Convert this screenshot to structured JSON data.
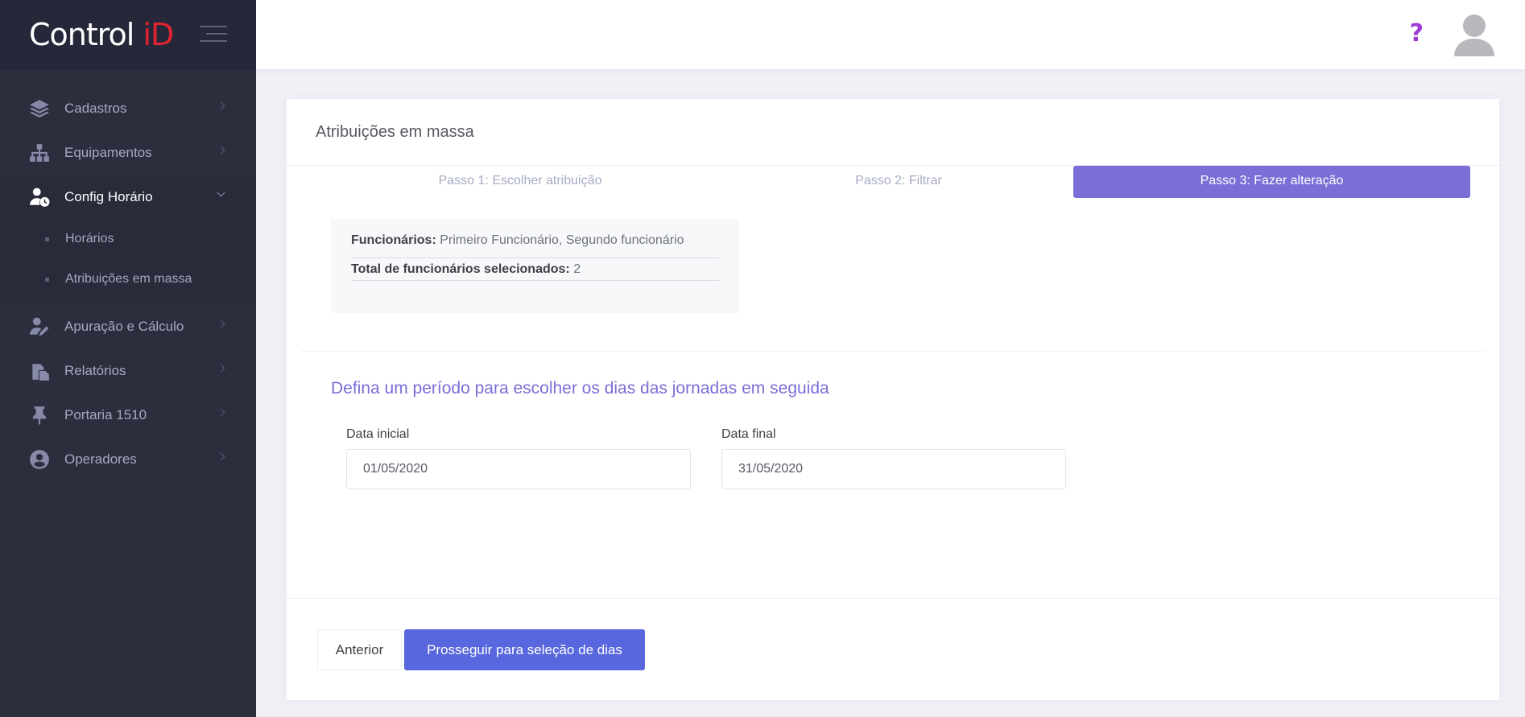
{
  "brand": {
    "logo_main": "Control ",
    "logo_accent": "iD"
  },
  "sidebar": {
    "items": [
      {
        "label": "Cadastros",
        "icon": "layers-icon"
      },
      {
        "label": "Equipamentos",
        "icon": "sitemap-icon"
      },
      {
        "label": "Config Horário",
        "icon": "user-clock-icon",
        "open": true,
        "subitems": [
          {
            "label": "Horários"
          },
          {
            "label": "Atribuições em massa"
          }
        ]
      },
      {
        "label": "Apuração e Cálculo",
        "icon": "user-edit-icon"
      },
      {
        "label": "Relatórios",
        "icon": "copy-files-icon"
      },
      {
        "label": "Portaria 1510",
        "icon": "thumbtack-icon"
      },
      {
        "label": "Operadores",
        "icon": "user-circle-icon"
      }
    ]
  },
  "header": {
    "help_label": "?"
  },
  "card": {
    "title": "Atribuições em massa",
    "steps": [
      {
        "label": "Passo 1: Escolher atribuição"
      },
      {
        "label": "Passo 2: Filtrar"
      },
      {
        "label": "Passo 3: Fazer alteração",
        "active": true
      }
    ],
    "summary": {
      "employees_label": "Funcionários:",
      "employees_value": " Primeiro Funcionário, Segundo funcionário",
      "total_label": "Total de funcionários selecionados:",
      "total_value": " 2"
    },
    "section_title": "Defina um período para escolher os dias das jornadas em seguida",
    "start_date": {
      "label": "Data inicial",
      "value": "01/05/2020"
    },
    "end_date": {
      "label": "Data final",
      "value": "31/05/2020"
    },
    "buttons": {
      "prev": "Anterior",
      "next": "Prosseguir para seleção de dias"
    }
  },
  "colors": {
    "sidebar_bg": "#2c2e3e",
    "accent_purple": "#7a6fd6",
    "primary_button": "#5867dd",
    "logo_red": "#e0232f",
    "help_purple": "#9b3bd6"
  }
}
